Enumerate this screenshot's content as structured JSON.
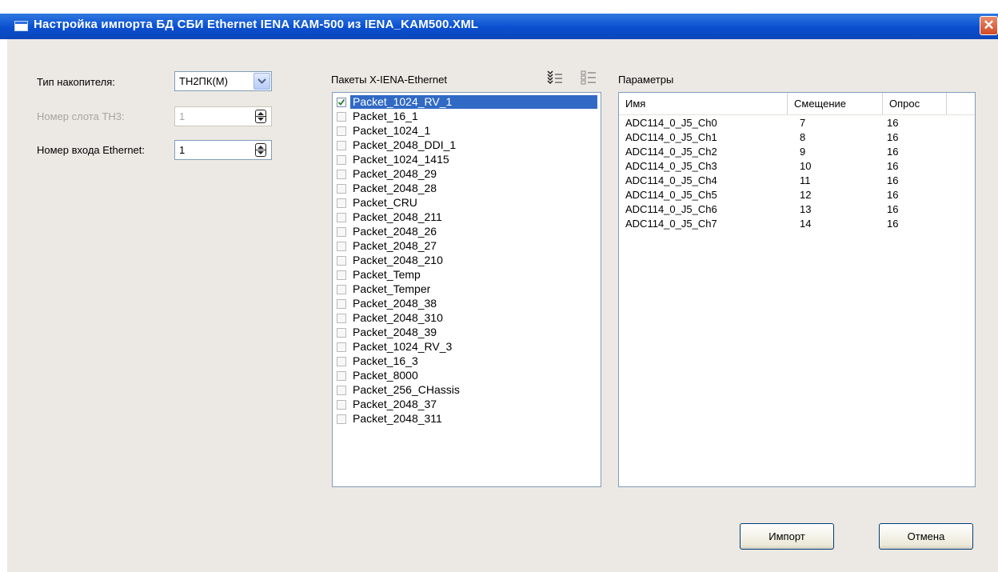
{
  "window": {
    "title": "Настройка импорта БД СБИ Ethernet IENA КАМ-500 из IENA_KAM500.XML",
    "close_label": "✕"
  },
  "settings": {
    "storage_type_label": "Тип накопителя:",
    "storage_type_value": "ТН2ПК(М)",
    "slot_label": "Номер слота ТН3:",
    "slot_value": "1",
    "ethernet_label": "Номер входа Ethernet:",
    "ethernet_value": "1"
  },
  "packets": {
    "title": "Пакеты X-IENA-Ethernet",
    "items": [
      {
        "label": "Packet_1024_RV_1",
        "checked": true
      },
      {
        "label": "Packet_16_1",
        "checked": false
      },
      {
        "label": "Packet_1024_1",
        "checked": false
      },
      {
        "label": "Packet_2048_DDI_1",
        "checked": false
      },
      {
        "label": "Packet_1024_1415",
        "checked": false
      },
      {
        "label": "Packet_2048_29",
        "checked": false
      },
      {
        "label": "Packet_2048_28",
        "checked": false
      },
      {
        "label": "Packet_CRU",
        "checked": false
      },
      {
        "label": "Packet_2048_211",
        "checked": false
      },
      {
        "label": "Packet_2048_26",
        "checked": false
      },
      {
        "label": "Packet_2048_27",
        "checked": false
      },
      {
        "label": "Packet_2048_210",
        "checked": false
      },
      {
        "label": "Packet_Temp",
        "checked": false
      },
      {
        "label": "Packet_Temper",
        "checked": false
      },
      {
        "label": "Packet_2048_38",
        "checked": false
      },
      {
        "label": "Packet_2048_310",
        "checked": false
      },
      {
        "label": "Packet_2048_39",
        "checked": false
      },
      {
        "label": "Packet_1024_RV_3",
        "checked": false
      },
      {
        "label": "Packet_16_3",
        "checked": false
      },
      {
        "label": "Packet_8000",
        "checked": false
      },
      {
        "label": "Packet_256_CHassis",
        "checked": false
      },
      {
        "label": "Packet_2048_37",
        "checked": false
      },
      {
        "label": "Packet_2048_311",
        "checked": false
      }
    ]
  },
  "params": {
    "title": "Параметры",
    "columns": [
      "Имя",
      "Смещение",
      "Опрос"
    ],
    "rows": [
      [
        "ADC114_0_J5_Ch0",
        "7",
        "16"
      ],
      [
        "ADC114_0_J5_Ch1",
        "8",
        "16"
      ],
      [
        "ADC114_0_J5_Ch2",
        "9",
        "16"
      ],
      [
        "ADC114_0_J5_Ch3",
        "10",
        "16"
      ],
      [
        "ADC114_0_J5_Ch4",
        "11",
        "16"
      ],
      [
        "ADC114_0_J5_Ch5",
        "12",
        "16"
      ],
      [
        "ADC114_0_J5_Ch6",
        "13",
        "16"
      ],
      [
        "ADC114_0_J5_Ch7",
        "14",
        "16"
      ]
    ]
  },
  "buttons": {
    "import": "Импорт",
    "cancel": "Отмена"
  },
  "colors": {
    "title_bar": "#0a4fd0",
    "selection": "#316ac5",
    "client_bg": "#ece9e4"
  }
}
